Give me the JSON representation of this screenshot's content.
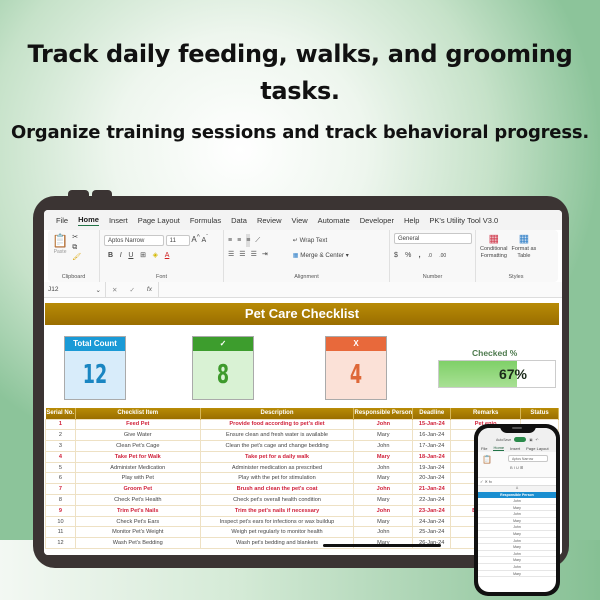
{
  "headline": "Track daily feeding, walks, and grooming tasks.",
  "subheadline": "Organize training sessions and track behavioral progress.",
  "excel": {
    "menu": [
      "File",
      "Home",
      "Insert",
      "Page Layout",
      "Formulas",
      "Data",
      "Review",
      "View",
      "Automate",
      "Developer",
      "Help",
      "PK's Utility Tool V3.0"
    ],
    "active_menu": "Home",
    "ribbon": {
      "clipboard": {
        "paste": "Paste",
        "label": "Clipboard"
      },
      "font": {
        "name": "Aptos Narrow",
        "size": "11",
        "label": "Font",
        "bold": "B",
        "italic": "I",
        "underline": "U"
      },
      "alignment": {
        "wrap": "Wrap Text",
        "merge": "Merge & Center",
        "label": "Alignment"
      },
      "number": {
        "format": "General",
        "currency": "$",
        "percent": "%",
        "comma": ",",
        "label": "Number"
      },
      "styles": {
        "conditional": "Conditional",
        "conditional2": "Formatting",
        "format_table": "Format as",
        "format_table2": "Table",
        "label": "Styles"
      }
    },
    "name_box": "J12",
    "fx": "fx"
  },
  "dashboard": {
    "title": "Pet Care Checklist",
    "kpis": [
      {
        "label": "Total Count",
        "value": "12",
        "color": "#1a9ad6"
      },
      {
        "label": "✓",
        "value": "8",
        "color": "#3d9d2d"
      },
      {
        "label": "X",
        "value": "4",
        "color": "#e8693b"
      }
    ],
    "checked_label": "Checked %",
    "checked_pct": 67,
    "checked_text": "67%"
  },
  "table": {
    "headers": [
      "Serial No.",
      "Checklist Item",
      "Description",
      "Responsible Person",
      "Deadline",
      "Remarks",
      "Status"
    ],
    "rows": [
      {
        "n": "1",
        "item": "Feed Pet",
        "desc": "Provide food according to pet's diet",
        "person": "John",
        "deadline": "15-Jan-24",
        "remarks": "Pet enjo",
        "hl": true
      },
      {
        "n": "2",
        "item": "Give Water",
        "desc": "Ensure clean and fresh water is available",
        "person": "Mary",
        "deadline": "16-Jan-24",
        "remarks": "Water l",
        "hl": false
      },
      {
        "n": "3",
        "item": "Clean Pet's Cage",
        "desc": "Clean the pet's cage and change bedding",
        "person": "John",
        "deadline": "17-Jan-24",
        "remarks": "Bedding",
        "hl": false
      },
      {
        "n": "4",
        "item": "Take Pet for Walk",
        "desc": "Take pet for a daily walk",
        "person": "Mary",
        "deadline": "18-Jan-24",
        "remarks": "Keep",
        "hl": true
      },
      {
        "n": "5",
        "item": "Administer Medication",
        "desc": "Administer medication as prescribed",
        "person": "John",
        "deadline": "19-Jan-24",
        "remarks": "Ensure",
        "hl": false
      },
      {
        "n": "6",
        "item": "Play with Pet",
        "desc": "Play with the pet for stimulation",
        "person": "Mary",
        "deadline": "20-Jan-24",
        "remarks": "Pet lo",
        "hl": false
      },
      {
        "n": "7",
        "item": "Groom Pet",
        "desc": "Brush and clean the pet's coat",
        "person": "John",
        "deadline": "21-Jan-24",
        "remarks": "Pet's c",
        "hl": true
      },
      {
        "n": "8",
        "item": "Check Pet's Health",
        "desc": "Check pet's overall health condition",
        "person": "Mary",
        "deadline": "22-Jan-24",
        "remarks": "Pet",
        "hl": false
      },
      {
        "n": "9",
        "item": "Trim Pet's Nails",
        "desc": "Trim the pet's nails if necessary",
        "person": "John",
        "deadline": "23-Jan-24",
        "remarks": "Be careful",
        "hl": true
      },
      {
        "n": "10",
        "item": "Check Pet's Ears",
        "desc": "Inspect pet's ears for infections or wax buildup",
        "person": "Mary",
        "deadline": "24-Jan-24",
        "remarks": "No info",
        "hl": false
      },
      {
        "n": "11",
        "item": "Monitor Pet's Weight",
        "desc": "Weigh pet regularly to monitor health",
        "person": "John",
        "deadline": "25-Jan-24",
        "remarks": "Weig",
        "hl": false
      },
      {
        "n": "12",
        "item": "Wash Pet's Bedding",
        "desc": "Wash pet's bedding and blankets",
        "person": "Mary",
        "deadline": "26-Jan-24",
        "remarks": "Beddin",
        "hl": false
      }
    ]
  },
  "phone": {
    "autosave": "AutoSave",
    "menu": [
      "File",
      "Home",
      "Insert",
      "Page Layout"
    ],
    "font_name": "Aptos Narrow",
    "col_letter": "A",
    "header": "Responsible Person",
    "people": [
      "John",
      "Mary",
      "John",
      "Mary",
      "John",
      "Mary",
      "John",
      "Mary",
      "John",
      "Mary",
      "John",
      "Mary"
    ]
  }
}
